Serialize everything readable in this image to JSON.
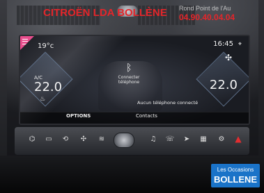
{
  "watermark": {
    "dealer": "CITROËN LDA BOLLÈNE",
    "address": "Rond Point de l'Au",
    "phone": "04.90.40.04.04"
  },
  "screen": {
    "outside_temp": "19°c",
    "clock": "16:45",
    "ac_label": "A/C",
    "left_temp": "22.0",
    "right_temp": "22.0",
    "bluetooth_line1": "Connecter",
    "bluetooth_line2": "téléphone",
    "no_phone": "Aucun téléphone connecté",
    "options_label": "OPTIONS",
    "contacts_label": "Contacts"
  },
  "icons": {
    "menu": "menu-icon",
    "location": "location-icon",
    "fan": "fan-icon",
    "seat_heat": "seat-heat-icon",
    "bluetooth": "bluetooth-icon",
    "hazard": "hazard-icon"
  },
  "overlay": {
    "line1": "Les Occasions",
    "line2": "BOLLENE"
  },
  "colors": {
    "menu_accent": "#e84c8c",
    "watermark_red": "#e5252a",
    "overlay_blue": "#1a73c8"
  }
}
